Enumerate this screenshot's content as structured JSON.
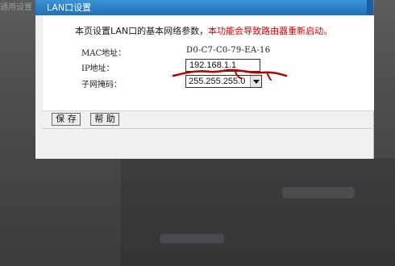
{
  "background": {
    "caption": "通用设置"
  },
  "dialog": {
    "title": "LAN口设置",
    "intro_text": "本页设置LAN口的基本网络参数，",
    "intro_warning": "本功能会导致路由器重新启动。",
    "fields": {
      "mac_label": "MAC地址：",
      "mac_value": "D0-C7-C0-79-EA-16",
      "ip_label": "IP地址：",
      "ip_value": "192.168.1.1",
      "mask_label": "子网掩码：",
      "mask_value": "255.255.255.0"
    },
    "buttons": {
      "save": "保 存",
      "help": "帮 助"
    }
  },
  "colors": {
    "titlebar": "#2b7ec4",
    "warning": "#d40000",
    "annotation": "#b00000"
  },
  "icons": [
    "dropdown-arrow-icon"
  ]
}
